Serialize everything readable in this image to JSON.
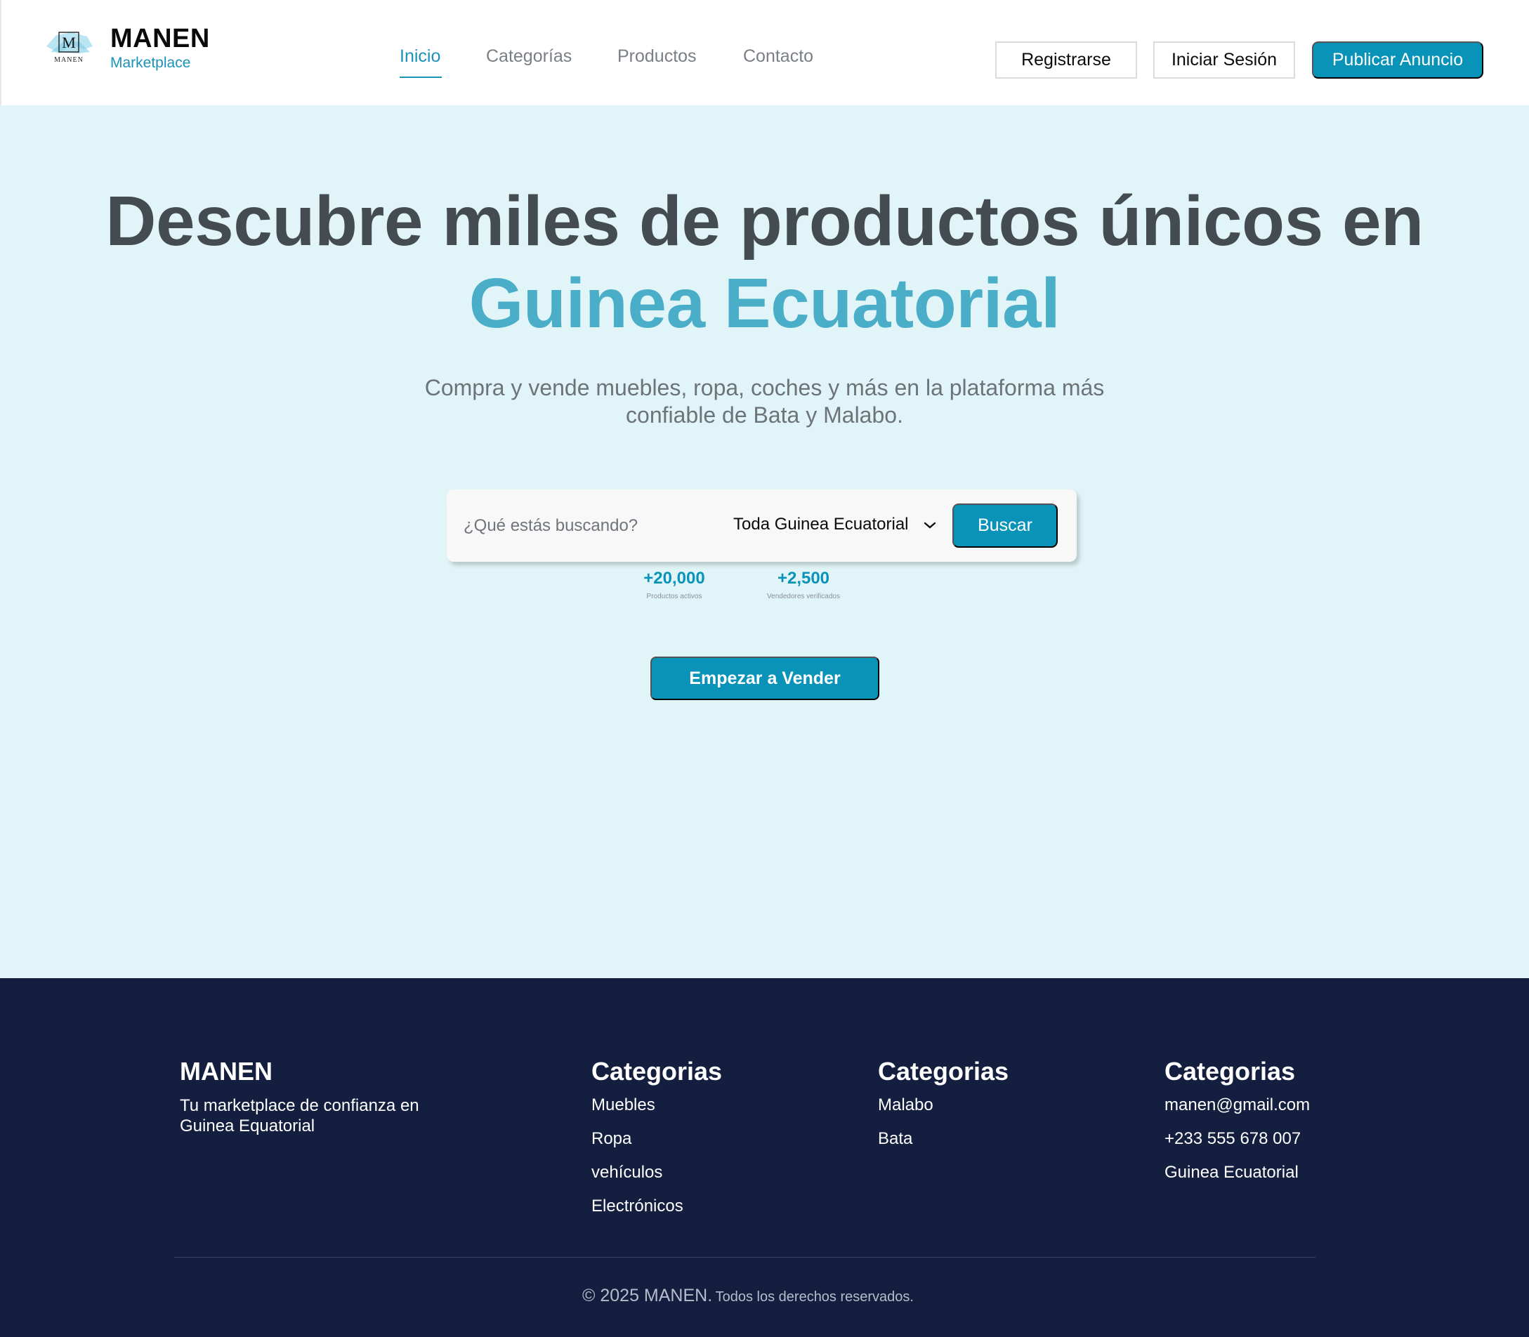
{
  "header": {
    "logo_text": "M",
    "logo_subtext": "MANEN",
    "brand_name": "MANEN",
    "brand_subtitle": "Marketplace",
    "nav": [
      {
        "label": "Inicio",
        "active": true
      },
      {
        "label": "Categorías",
        "active": false
      },
      {
        "label": "Productos",
        "active": false
      },
      {
        "label": "Contacto",
        "active": false
      }
    ],
    "register_label": "Registrarse",
    "login_label": "Iniciar Sesión",
    "publish_label": "Publicar Anuncio"
  },
  "hero": {
    "title_line1": "Descubre miles de productos únicos en",
    "title_line2": "Guinea Ecuatorial",
    "subtitle": "Compra y vende muebles, ropa, coches y más en la plataforma más confiable de Bata y Malabo.",
    "search": {
      "placeholder": "¿Qué estás buscando?",
      "location": "Toda Guinea Ecuatorial",
      "button_label": "Buscar"
    },
    "stats": [
      {
        "value": "+20,000",
        "label": "Productos activos"
      },
      {
        "value": "+2,500",
        "label": "Vendedores verificados"
      }
    ],
    "cta_label": "Empezar a Vender"
  },
  "footer": {
    "brand": "MANEN",
    "tagline": "Tu marketplace de confianza en Guinea Equatorial",
    "columns": [
      {
        "title": "Categorias",
        "items": [
          "Muebles",
          "Ropa",
          "vehículos",
          "Electrónicos"
        ]
      },
      {
        "title": "Categorias",
        "items": [
          "Malabo",
          "Bata"
        ]
      },
      {
        "title": "Categorias",
        "items": [
          "manen@gmail.com",
          "+233 555 678 007",
          "Guinea Ecuatorial"
        ]
      }
    ],
    "copyright_main": "© 2025 MANEN.",
    "copyright_rest": "Todos los derechos reservados."
  },
  "colors": {
    "accent": "#0a93b8",
    "hero_background": "#e1f5f8",
    "title_highlight": "#4aaec9",
    "footer_background": "#141e3f"
  },
  "icons": [
    "manen-logo-icon",
    "chevron-down-icon"
  ]
}
